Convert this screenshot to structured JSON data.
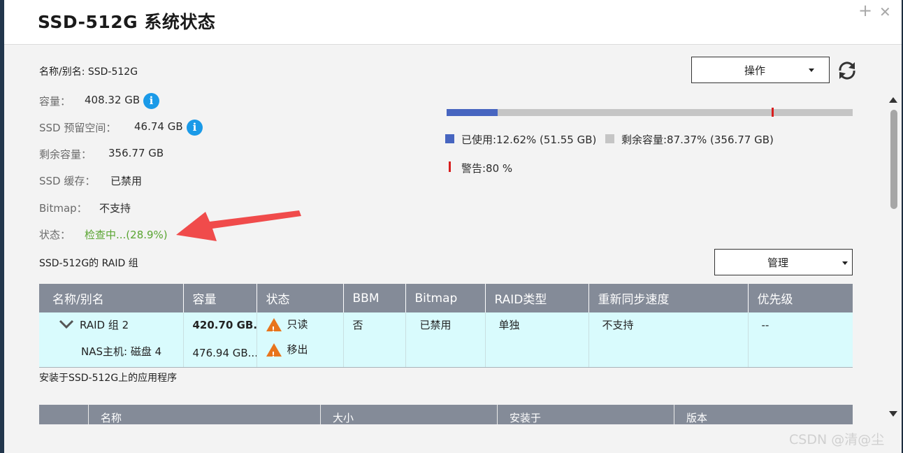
{
  "window": {
    "title": "SSD-512G  系统状态",
    "add_icon": "+",
    "close_icon": "✕"
  },
  "info": {
    "name": "名称/别名: SSD-512G",
    "capacity_label": "容量：",
    "capacity_value": "408.32 GB",
    "reserved_label": "SSD 预留空间：",
    "reserved_value": "46.74 GB",
    "free_label": "剩余容量：",
    "free_value": "356.77 GB",
    "cache_label": "SSD 缓存：",
    "cache_value": "已禁用",
    "bitmap_label": "Bitmap：",
    "bitmap_value": "不支持",
    "status_label": "状态：",
    "status_value": "检查中...(28.9%)"
  },
  "actions": {
    "operate_label": "操作",
    "manage_label": "管理",
    "refresh_icon": "refresh-icon"
  },
  "usage": {
    "used_fraction": 0.1262,
    "warn_fraction": 0.8,
    "used_text": "已使用:12.62% (51.55 GB)",
    "free_text": "剩余容量:87.37% (356.77 GB)",
    "warn_text": "警告:80 %",
    "used_color": "#4765c0",
    "free_color": "#c5c5c5",
    "warn_color": "#d81e1e"
  },
  "raid": {
    "section_title": "SSD-512G的 RAID 组",
    "columns": [
      "名称/别名",
      "容量",
      "状态",
      "BBM",
      "Bitmap",
      "RAID类型",
      "重新同步速度",
      "优先级"
    ],
    "group": {
      "name": "RAID 组 2",
      "disk": "NAS主机: 磁盘 4",
      "capacity": "420.70 GB...",
      "disk_capacity": "476.94 GB...",
      "status": "只读",
      "disk_status": "移出",
      "bbm": "否",
      "bitmap": "已禁用",
      "raid_type": "单独",
      "resync": "不支持",
      "priority": "--"
    }
  },
  "apps": {
    "section_title": "安装于SSD-512G上的应用程序",
    "columns": [
      "名称",
      "大小",
      "安装于",
      "版本"
    ]
  },
  "watermark": "CSDN @清@尘"
}
